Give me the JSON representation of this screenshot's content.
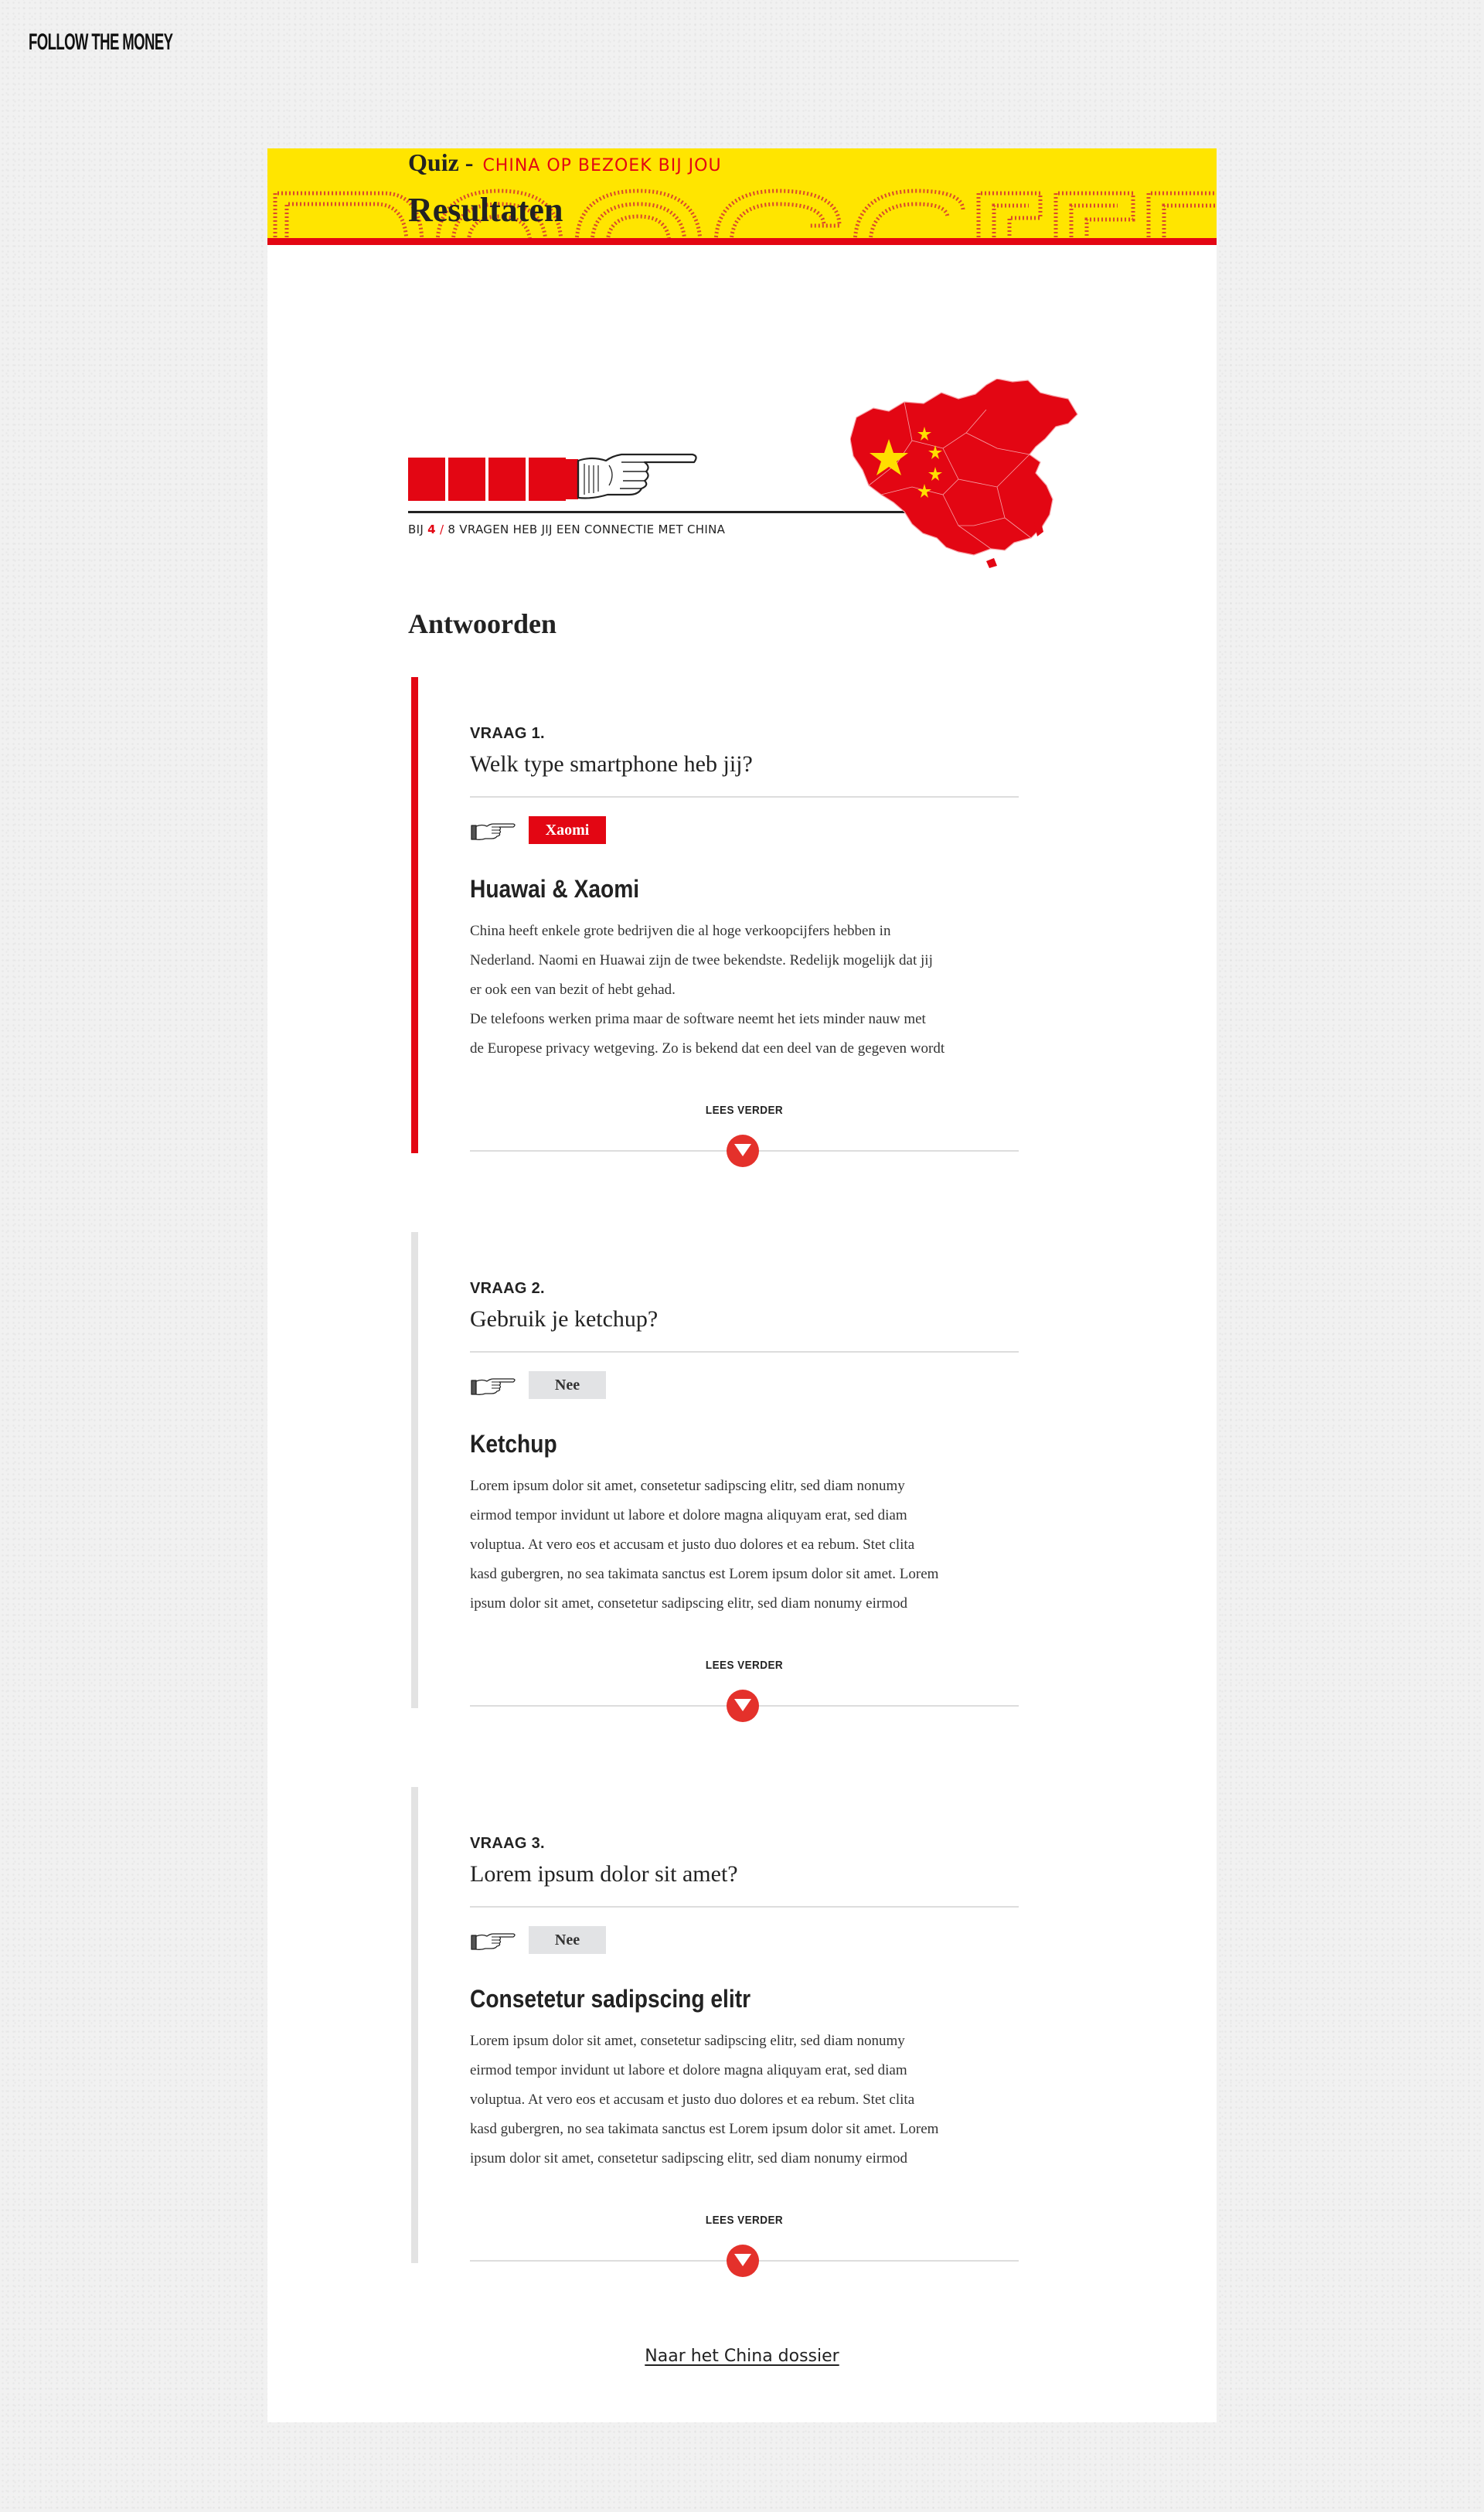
{
  "brand": {
    "logo": "FOLLOW THE MONEY"
  },
  "header": {
    "quiz_label": "Quiz -",
    "quiz_subtitle": "CHINA OP BEZOEK BIJ JOU",
    "title": "Resultaten"
  },
  "score": {
    "prefix": "BIJ",
    "value": "4",
    "separator": "/",
    "suffix": "8 VRAGEN HEB JIJ EEN CONNECTIE MET CHINA",
    "connections": 4,
    "total": 8
  },
  "answers_title": "Antwoorden",
  "questions": [
    {
      "number": "VRAAG 1.",
      "question": "Welk type smartphone heb jij?",
      "answer": "Xaomi",
      "connected": true,
      "heading": "Huawai & Xaomi",
      "body_lines": [
        "China heeft enkele grote bedrijven die al hoge verkoopcijfers hebben in",
        "Nederland. Naomi en Huawai zijn de twee bekendste. Redelijk mogelijk dat jij",
        "er ook een van bezit of hebt gehad.",
        "De telefoons werken prima maar de software neemt het iets minder nauw met",
        "de Europese privacy wetgeving. Zo is bekend dat een deel van de gegeven wordt"
      ],
      "read_more": "LEES VERDER"
    },
    {
      "number": "VRAAG 2.",
      "question": "Gebruik je ketchup?",
      "answer": "Nee",
      "connected": false,
      "heading": "Ketchup",
      "body_lines": [
        "Lorem ipsum dolor sit amet, consetetur sadipscing elitr, sed diam nonumy",
        "eirmod tempor invidunt ut labore et dolore magna aliquyam erat, sed diam",
        "voluptua. At vero eos et accusam et justo duo dolores et ea rebum. Stet clita",
        "kasd gubergren, no sea takimata sanctus est Lorem ipsum dolor sit amet. Lorem",
        "ipsum dolor sit amet, consetetur sadipscing elitr, sed diam nonumy eirmod"
      ],
      "read_more": "LEES VERDER"
    },
    {
      "number": "VRAAG 3.",
      "question": "Lorem ipsum dolor sit amet?",
      "answer": "Nee",
      "connected": false,
      "heading": "Consetetur sadipscing elitr",
      "body_lines": [
        "Lorem ipsum dolor sit amet, consetetur sadipscing elitr, sed diam nonumy",
        "eirmod tempor invidunt ut labore et dolore magna aliquyam erat, sed diam",
        "voluptua. At vero eos et accusam et justo duo dolores et ea rebum. Stet clita",
        "kasd gubergren, no sea takimata sanctus est Lorem ipsum dolor sit amet. Lorem",
        "ipsum dolor sit amet, consetetur sadipscing elitr, sed diam nonumy eirmod"
      ],
      "read_more": "LEES VERDER"
    }
  ],
  "footer": {
    "dossier_link": "Naar het China dossier"
  },
  "icons": {
    "pointing_hand": "pointing-hand-icon",
    "read_more": "chevron-down-icon",
    "map": "china-flag-map"
  },
  "colors": {
    "accent_red": "#e30613",
    "banner_yellow": "#ffe500",
    "answer_neutral": "#e2e3e5"
  }
}
